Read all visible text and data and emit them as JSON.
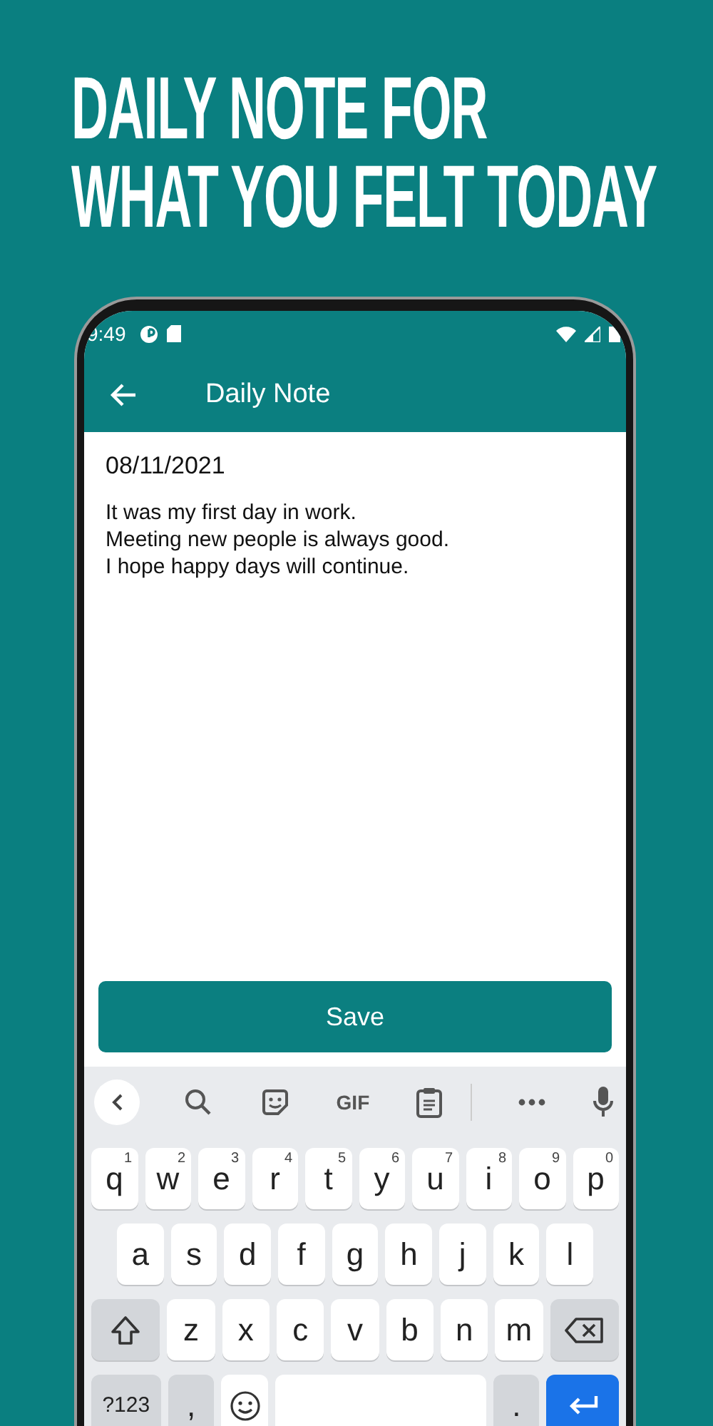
{
  "headline": [
    "DAILY NOTE FOR",
    "WHAT YOU FELT TODAY"
  ],
  "status_bar": {
    "time": "9:49"
  },
  "app_bar": {
    "title": "Daily Note"
  },
  "note": {
    "date": "08/11/2021",
    "text": "It was my first day in work.\nMeeting new people is always good.\nI hope happy days will continue."
  },
  "save_button": "Save",
  "keyboard": {
    "toolbar": [
      {
        "kind": "back"
      },
      {
        "kind": "search"
      },
      {
        "kind": "sticker"
      },
      {
        "kind": "gif",
        "label": "GIF"
      },
      {
        "kind": "clipboard"
      },
      {
        "kind": "more"
      },
      {
        "kind": "mic"
      }
    ],
    "key_rows": [
      {
        "keys": [
          {
            "kind": "letter",
            "label": "q",
            "hint": "1"
          },
          {
            "kind": "letter",
            "label": "w",
            "hint": "2"
          },
          {
            "kind": "letter",
            "label": "e",
            "hint": "3"
          },
          {
            "kind": "letter",
            "label": "r",
            "hint": "4"
          },
          {
            "kind": "letter",
            "label": "t",
            "hint": "5"
          },
          {
            "kind": "letter",
            "label": "y",
            "hint": "6"
          },
          {
            "kind": "letter",
            "label": "u",
            "hint": "7"
          },
          {
            "kind": "letter",
            "label": "i",
            "hint": "8"
          },
          {
            "kind": "letter",
            "label": "o",
            "hint": "9"
          },
          {
            "kind": "letter",
            "label": "p",
            "hint": "0"
          }
        ]
      },
      {
        "keys": [
          {
            "kind": "letter",
            "label": "a"
          },
          {
            "kind": "letter",
            "label": "s"
          },
          {
            "kind": "letter",
            "label": "d"
          },
          {
            "kind": "letter",
            "label": "f"
          },
          {
            "kind": "letter",
            "label": "g"
          },
          {
            "kind": "letter",
            "label": "h"
          },
          {
            "kind": "letter",
            "label": "j"
          },
          {
            "kind": "letter",
            "label": "k"
          },
          {
            "kind": "letter",
            "label": "l"
          }
        ]
      },
      {
        "keys": [
          {
            "kind": "shift"
          },
          {
            "kind": "letter",
            "label": "z"
          },
          {
            "kind": "letter",
            "label": "x"
          },
          {
            "kind": "letter",
            "label": "c"
          },
          {
            "kind": "letter",
            "label": "v"
          },
          {
            "kind": "letter",
            "label": "b"
          },
          {
            "kind": "letter",
            "label": "n"
          },
          {
            "kind": "letter",
            "label": "m"
          },
          {
            "kind": "backspace"
          }
        ]
      },
      {
        "keys": [
          {
            "kind": "symbols",
            "label": "?123"
          },
          {
            "kind": "punct",
            "label": ","
          },
          {
            "kind": "emoji"
          },
          {
            "kind": "space"
          },
          {
            "kind": "punct",
            "label": "."
          },
          {
            "kind": "enter"
          }
        ]
      }
    ]
  }
}
